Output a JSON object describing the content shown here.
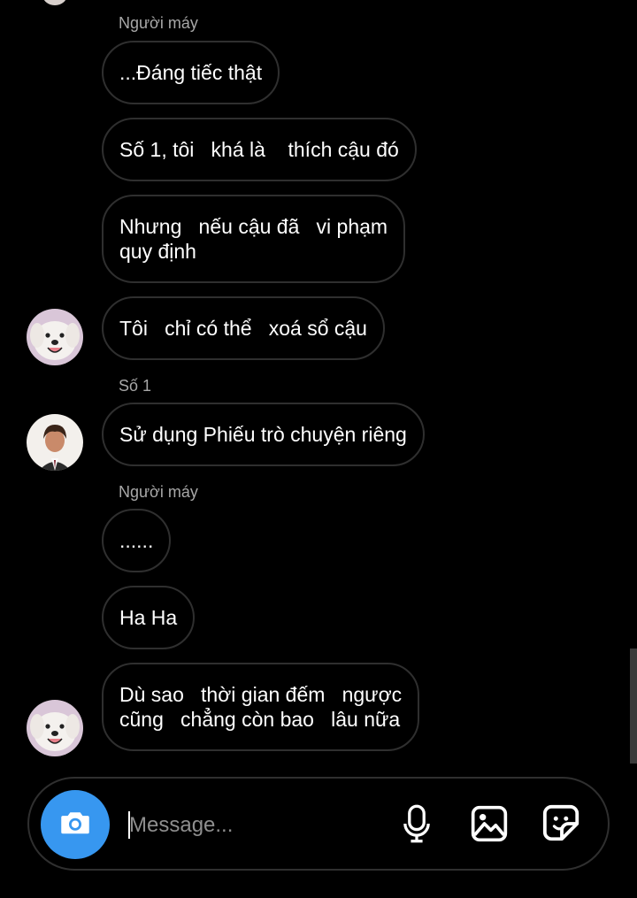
{
  "thread": {
    "groups": [
      {
        "sender": "Người máy",
        "messages": [
          "...Đáng tiếc thật",
          "Số 1, tôi   khá là    thích cậu đó",
          "Nhưng   nếu cậu đã   vi phạm\nquy định",
          "Tôi   chỉ có thể   xoá sổ cậu"
        ],
        "avatar": "dog-avatar"
      },
      {
        "sender": "Số 1",
        "messages": [
          "Sử dụng Phiếu trò chuyện riêng"
        ],
        "avatar": "boy-avatar"
      },
      {
        "sender": "Người máy",
        "messages": [
          "......",
          "Ha Ha",
          "Dù sao   thời gian đếm   ngược\ncũng   chẳng còn bao   lâu nữa"
        ],
        "avatar": "dog-avatar"
      }
    ]
  },
  "composer": {
    "placeholder": "Message...",
    "value": "",
    "icons": [
      "camera-icon",
      "microphone-icon",
      "gallery-icon",
      "sticker-icon"
    ],
    "camera_color": "#3797f0"
  }
}
